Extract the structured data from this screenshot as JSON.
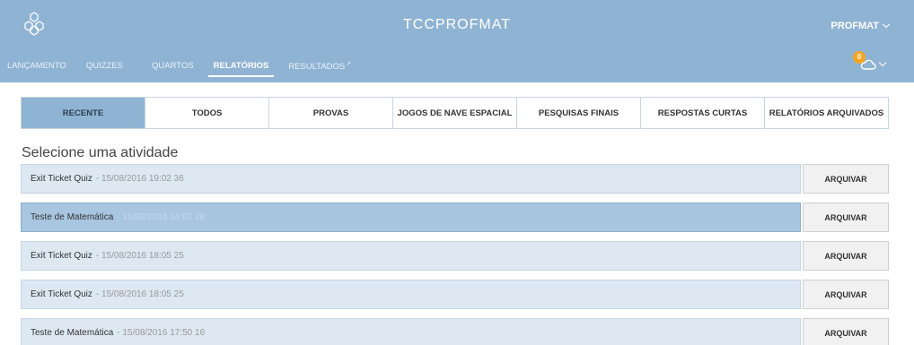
{
  "header": {
    "title": "TCCPROFMAT",
    "user": "PROFMAT",
    "notification_count": "0",
    "brand_color": "#8fb3d3"
  },
  "nav": [
    {
      "label": "LANÇAMENTO"
    },
    {
      "label": "QUIZZES"
    },
    {
      "label": "QUARTOS"
    },
    {
      "label": "RELATÓRIOS",
      "active": true
    },
    {
      "label": "RESULTADOS"
    }
  ],
  "tabs": [
    {
      "label": "RECENTE",
      "active": true
    },
    {
      "label": "TODOS"
    },
    {
      "label": "PROVAS"
    },
    {
      "label": "JOGOS DE NAVE ESPACIAL"
    },
    {
      "label": "PESQUISAS FINAIS"
    },
    {
      "label": "RESPOSTAS CURTAS"
    },
    {
      "label": "RELATÓRIOS ARQUIVADOS"
    }
  ],
  "section_title": "Selecione uma atividade",
  "activities": [
    {
      "title": "Exit Ticket Quiz",
      "date": "- 15/08/2016 19:02 36",
      "action": "ARQUIVAR"
    },
    {
      "title": "Teste de Matemática",
      "date": "- 15/08/2016 18:07 28",
      "action": "ARQUIVAR",
      "selected": true
    },
    {
      "title": "Exit Ticket Quiz",
      "date": "- 15/08/2016 18:05 25",
      "action": "ARQUIVAR"
    },
    {
      "title": "Exit Ticket Quiz",
      "date": "- 15/08/2016 18:05 25",
      "action": "ARQUIVAR"
    },
    {
      "title": "Teste de Matemática",
      "date": "- 15/08/2016 17:50 16",
      "action": "ARQUIVAR"
    }
  ],
  "icons": {
    "logo": "hexagon-logo-icon",
    "user_menu": "chevron-down-icon",
    "notifications": "cloud-icon"
  }
}
